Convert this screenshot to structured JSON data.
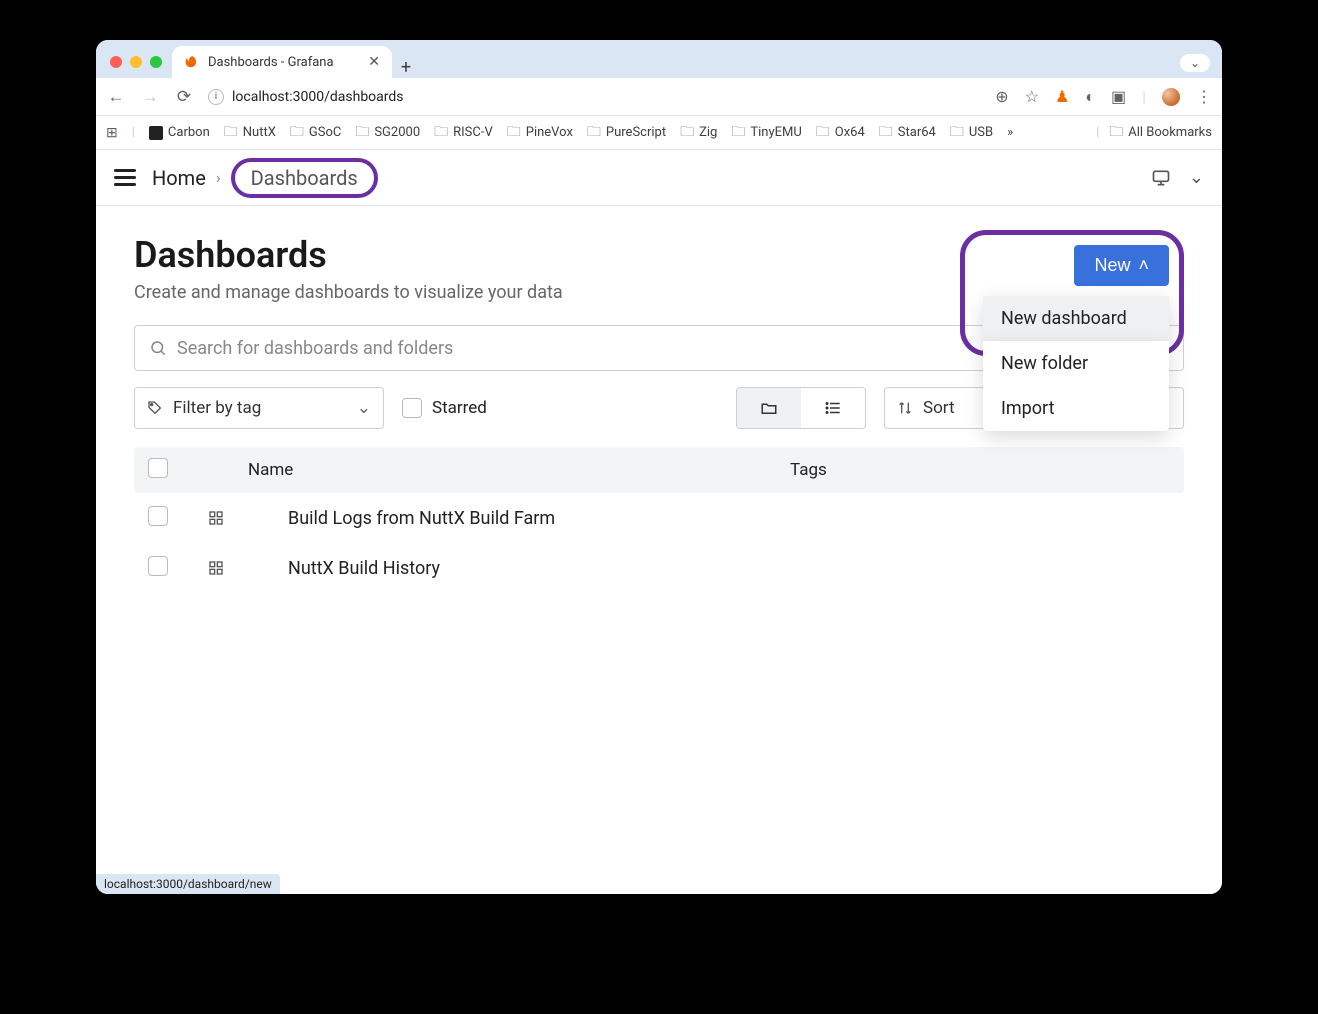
{
  "browser": {
    "tab_title": "Dashboards - Grafana",
    "url": "localhost:3000/dashboards",
    "status_url": "localhost:3000/dashboard/new",
    "bookmarks": [
      "Carbon",
      "NuttX",
      "GSoC",
      "SG2000",
      "RISC-V",
      "PineVox",
      "PureScript",
      "Zig",
      "TinyEMU",
      "Ox64",
      "Star64",
      "USB"
    ],
    "bookmarks_overflow": "»",
    "all_bookmarks": "All Bookmarks"
  },
  "breadcrumb": {
    "home": "Home",
    "current": "Dashboards"
  },
  "page": {
    "title": "Dashboards",
    "subtitle": "Create and manage dashboards to visualize your data",
    "search_placeholder": "Search for dashboards and folders",
    "filter_tag": "Filter by tag",
    "starred": "Starred",
    "sort": "Sort"
  },
  "new_button": {
    "label": "New",
    "menu": [
      "New dashboard",
      "New folder",
      "Import"
    ]
  },
  "table": {
    "col_name": "Name",
    "col_tags": "Tags",
    "rows": [
      {
        "name": "Build Logs from NuttX Build Farm"
      },
      {
        "name": "NuttX Build History"
      }
    ]
  }
}
